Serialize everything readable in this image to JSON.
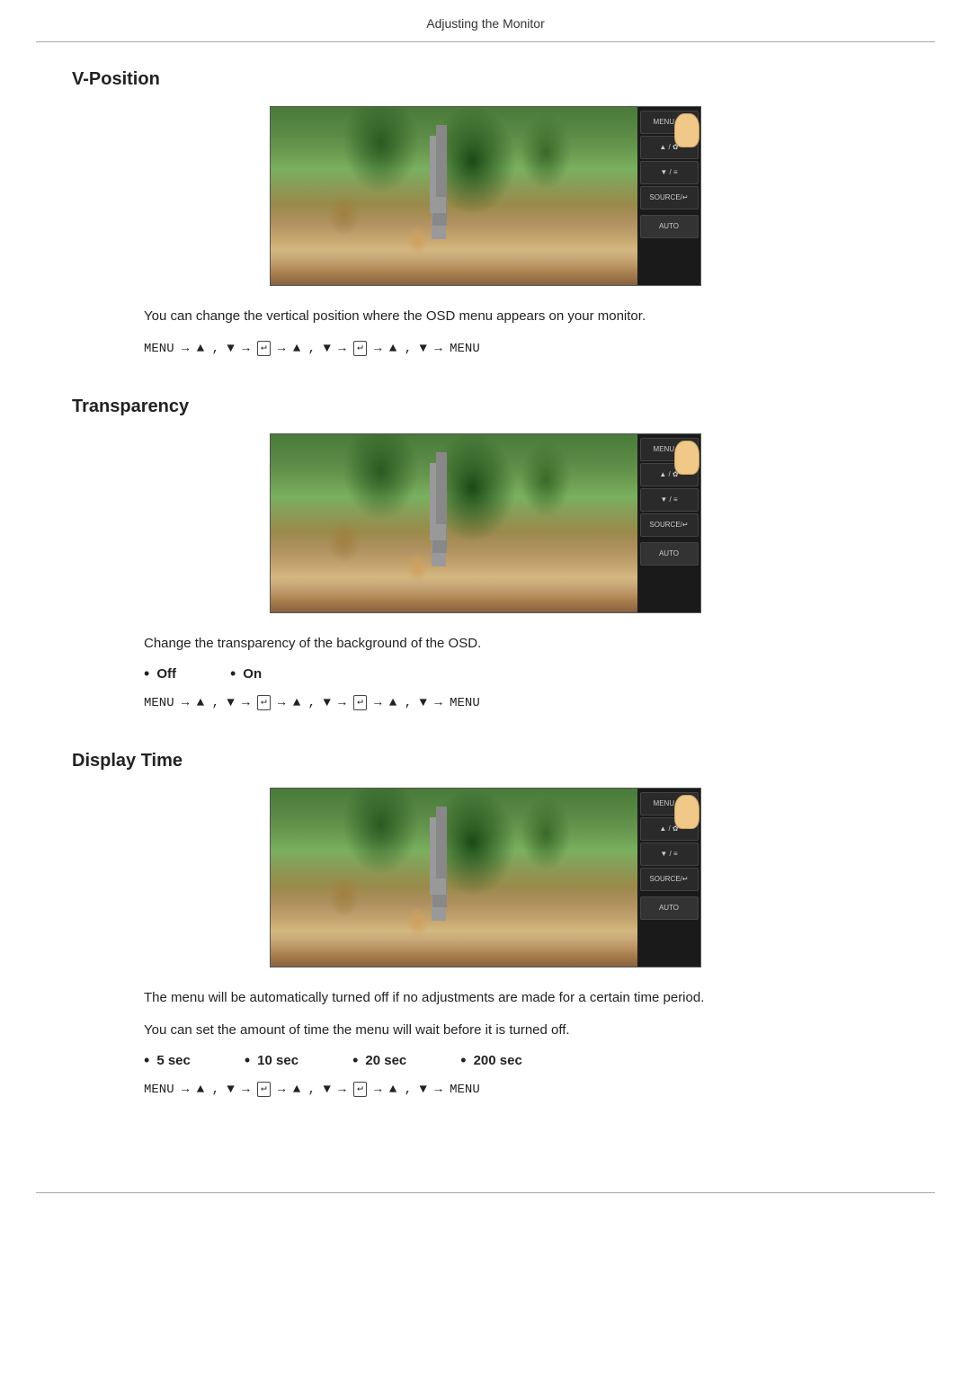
{
  "header": {
    "title": "Adjusting the Monitor"
  },
  "sections": [
    {
      "id": "v-position",
      "title": "V-Position",
      "description": "You can change the vertical position where the OSD menu appears on your monitor.",
      "nav": "MENU → ▲ , ▼ → ↵ → ▲ , ▼ → ↵ → ▲ , ▼ → MENU",
      "bullets": []
    },
    {
      "id": "transparency",
      "title": "Transparency",
      "description": "Change the transparency of the background of the OSD.",
      "nav": "MENU → ▲ , ▼ → ↵ → ▲ , ▼ → ↵ → ▲ , ▼ → MENU",
      "bullets": [
        {
          "label": "Off"
        },
        {
          "label": "On"
        }
      ]
    },
    {
      "id": "display-time",
      "title": "Display Time",
      "descriptions": [
        "The menu will be automatically turned off if no adjustments are made for a certain time period.",
        "You can set the amount of time the menu will wait before it is turned off."
      ],
      "nav": "MENU → ▲ , ▼ → ↵ → ▲ , ▼ → ↵ → ▲ , ▼ → MENU",
      "bullets": [
        {
          "label": "5 sec"
        },
        {
          "label": "10 sec"
        },
        {
          "label": "20 sec"
        },
        {
          "label": "200 sec"
        }
      ]
    }
  ],
  "sidebar_buttons": [
    {
      "label": "MENU / ≡≡"
    },
    {
      "label": "▲ / ✿"
    },
    {
      "label": "▼ / ≡≡"
    },
    {
      "label": "SOURCE / ↵"
    },
    {
      "label": "AUTO"
    }
  ]
}
